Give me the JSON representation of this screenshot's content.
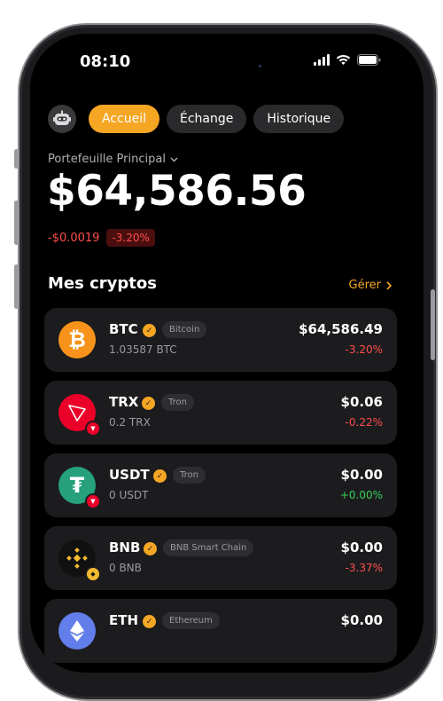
{
  "status_bar": {
    "time": "08:10"
  },
  "nav": {
    "tabs": [
      {
        "label": "Accueil",
        "active": true
      },
      {
        "label": "Échange",
        "active": false
      },
      {
        "label": "Historique",
        "active": false
      }
    ]
  },
  "wallet": {
    "name": "Portefeuille Principal",
    "balance": "$64,586.56",
    "change_amount": "-$0.0019",
    "change_percent": "-3.20%"
  },
  "section": {
    "title": "Mes cryptos",
    "manage_label": "Gérer"
  },
  "assets": [
    {
      "symbol": "BTC",
      "network": "Bitcoin",
      "amount": "1.03587 BTC",
      "usd_value": "$64,586.49",
      "change": "-3.20%",
      "trend": "down",
      "icon": "bitcoin-icon",
      "color": "#f7931a"
    },
    {
      "symbol": "TRX",
      "network": "Tron",
      "amount": "0.2 TRX",
      "usd_value": "$0.06",
      "change": "-0.22%",
      "trend": "down",
      "icon": "tron-icon",
      "color": "#eb0029"
    },
    {
      "symbol": "USDT",
      "network": "Tron",
      "amount": "0 USDT",
      "usd_value": "$0.00",
      "change": "+0.00%",
      "trend": "up",
      "icon": "tether-icon",
      "color": "#26a17b"
    },
    {
      "symbol": "BNB",
      "network": "BNB Smart Chain",
      "amount": "0 BNB",
      "usd_value": "$0.00",
      "change": "-3.37%",
      "trend": "down",
      "icon": "bnb-icon",
      "color": "#f3ba2f"
    },
    {
      "symbol": "ETH",
      "network": "Ethereum",
      "amount": "",
      "usd_value": "$0.00",
      "change": "",
      "trend": "down",
      "icon": "ethereum-icon",
      "color": "#627eea"
    }
  ],
  "colors": {
    "accent": "#f5a623",
    "negative": "#ff4d4d",
    "positive": "#34d058",
    "background": "#000000",
    "card": "#1c1c1e"
  }
}
